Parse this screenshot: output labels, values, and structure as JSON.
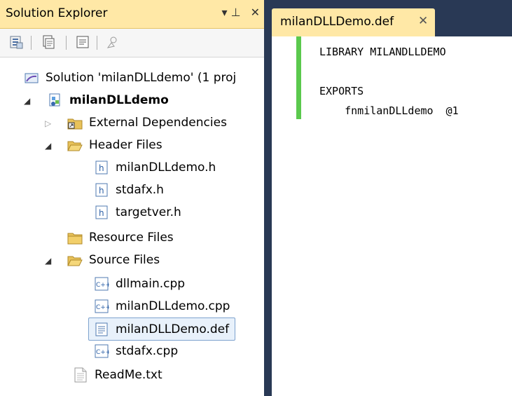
{
  "solution_explorer": {
    "title": "Solution Explorer",
    "pin_glyph": "▾ ⊥",
    "close_glyph": "✕",
    "toolbar_icons": [
      "properties-icon",
      "show-all-files-icon",
      "view-code-icon",
      "search-icon"
    ]
  },
  "tree": {
    "solution": "Solution 'milanDLLdemo' (1 proj",
    "project": "milanDLLdemo",
    "external_dependencies": "External Dependencies",
    "header_files": "Header Files",
    "header_items": [
      "milanDLLdemo.h",
      "stdafx.h",
      "targetver.h"
    ],
    "resource_files": "Resource Files",
    "source_files": "Source Files",
    "source_items": [
      "dllmain.cpp",
      "milanDLLdemo.cpp",
      "milanDLLDemo.def",
      "stdafx.cpp"
    ],
    "readme": "ReadMe.txt",
    "selected_item": "milanDLLDemo.def"
  },
  "editor": {
    "tab_label": "milanDLLDemo.def",
    "tab_close": "✕",
    "lines": [
      "LIBRARY MILANDLLDEMO",
      "",
      "EXPORTS",
      "    fnmilanDLLdemo  @1"
    ]
  },
  "colors": {
    "chrome": "#293955",
    "active_title": "#ffe8a6",
    "change_bar": "#5bc94d",
    "selection_border": "#7da2ce"
  }
}
